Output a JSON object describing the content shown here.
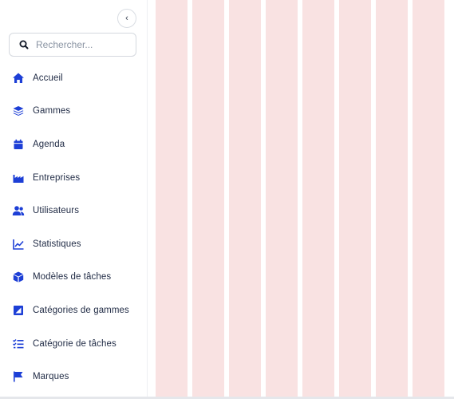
{
  "sidebar": {
    "collapse_glyph": "‹",
    "search": {
      "placeholder": "Rechercher..."
    },
    "items": [
      {
        "label": "Accueil",
        "icon": "home-icon"
      },
      {
        "label": "Gammes",
        "icon": "layers-icon"
      },
      {
        "label": "Agenda",
        "icon": "calendar-icon"
      },
      {
        "label": "Entreprises",
        "icon": "factory-icon"
      },
      {
        "label": "Utilisateurs",
        "icon": "users-icon"
      },
      {
        "label": "Statistiques",
        "icon": "chart-line-icon"
      },
      {
        "label": "Modèles de tâches",
        "icon": "cube-icon"
      },
      {
        "label": "Catégories de gammes",
        "icon": "category-icon"
      },
      {
        "label": "Catégorie de tâches",
        "icon": "checklist-icon"
      },
      {
        "label": "Marques",
        "icon": "flag-icon"
      }
    ]
  },
  "colors": {
    "accent": "#1d3fd6",
    "column_fill": "#f9e2e2"
  }
}
